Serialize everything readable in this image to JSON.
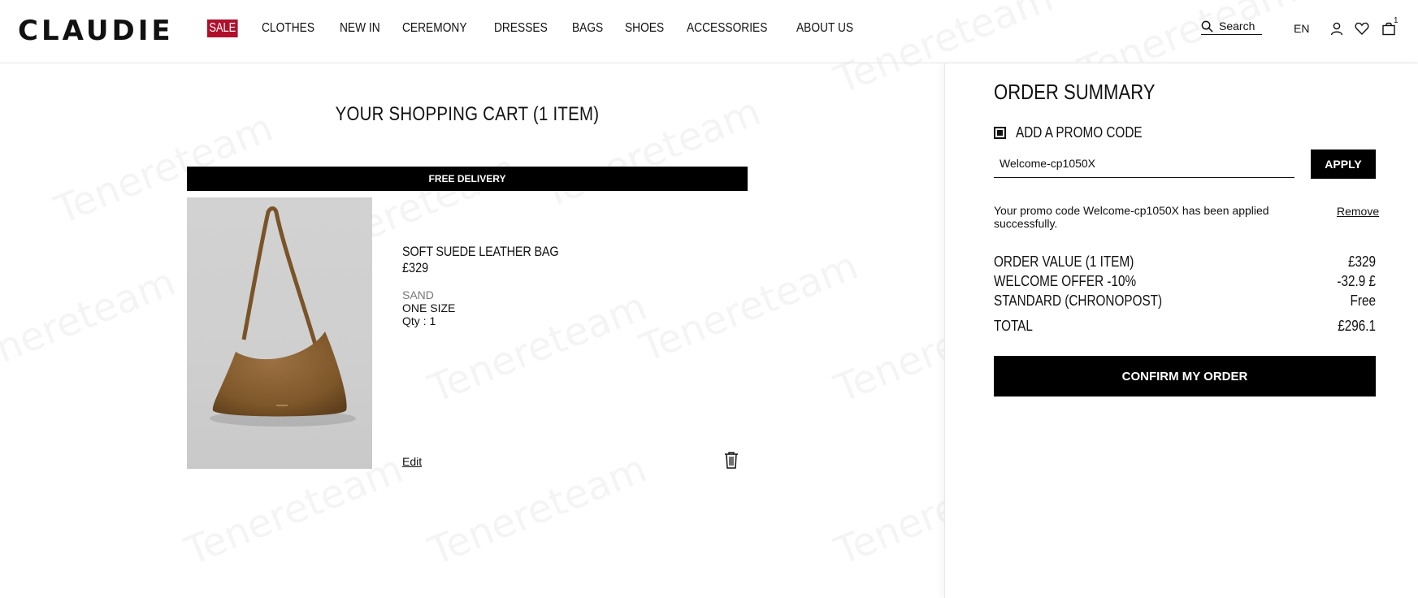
{
  "header": {
    "logo": "CLAUDIE",
    "nav": {
      "sale": "SALE",
      "items": [
        "CLOTHES",
        "NEW IN",
        "CEREMONY",
        "DRESSES",
        "BAGS",
        "SHOES",
        "ACCESSORIES",
        "ABOUT US"
      ]
    },
    "search_label": "Search",
    "language": "EN",
    "cart_count": "1",
    "icons": [
      "search-icon",
      "account-icon",
      "wishlist-heart-icon",
      "shopping-bag-icon"
    ]
  },
  "watermark": "Tenereteam",
  "cart": {
    "title": "YOUR SHOPPING CART (1 ITEM)",
    "delivery_banner": "FREE DELIVERY",
    "item": {
      "name": "SOFT SUEDE LEATHER BAG",
      "price": "£329",
      "color": "SAND",
      "size": "ONE SIZE",
      "qty": "Qty : 1",
      "edit_label": "Edit"
    }
  },
  "summary": {
    "title": "ORDER SUMMARY",
    "promo_label": "ADD A PROMO CODE",
    "promo_value": "Welcome-cp1050X",
    "apply_label": "APPLY",
    "promo_message": "Your promo code Welcome-cp1050X has been applied successfully.",
    "remove_label": "Remove",
    "lines": [
      {
        "label": "ORDER VALUE (1 ITEM)",
        "value": "£329"
      },
      {
        "label": "WELCOME OFFER -10%",
        "value": "-32.9 £"
      },
      {
        "label": "STANDARD (CHRONOPOST)",
        "value": "Free"
      },
      {
        "label": "TOTAL",
        "value": "£296.1"
      }
    ],
    "confirm_label": "CONFIRM MY ORDER"
  },
  "colors": {
    "sale_bg": "#b0102c",
    "button_bg": "#000000",
    "product_bg": "#cfcfcf",
    "bag_color": "#8a6336"
  }
}
